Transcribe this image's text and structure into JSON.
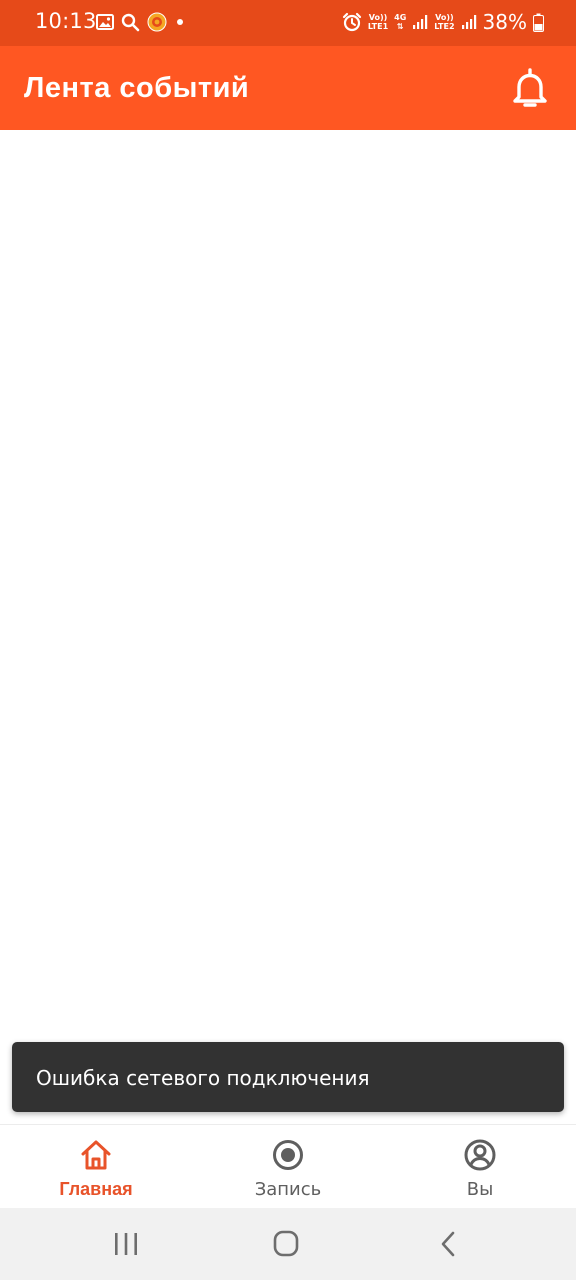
{
  "status_bar": {
    "time": "10:13",
    "battery_percent": "38%",
    "sim1_top": "Vo))",
    "sim1_bottom": "LTE1",
    "network_type": "4G",
    "sim2_top": "Vo))",
    "sim2_bottom": "LTE2",
    "background_color": "#e64a19"
  },
  "app_bar": {
    "title": "Лента событий",
    "background_color": "#ff5722",
    "notification_icon": "bell-icon"
  },
  "snackbar": {
    "message": "Ошибка сетевого подключения"
  },
  "bottom_nav": {
    "active_color": "#e8532a",
    "items": [
      {
        "label": "Главная",
        "icon": "home-icon",
        "active": true
      },
      {
        "label": "Запись",
        "icon": "record-icon",
        "active": false
      },
      {
        "label": "Вы",
        "icon": "profile-icon",
        "active": false
      }
    ]
  },
  "system_nav": {
    "buttons": [
      "recent-apps-icon",
      "home-circle-icon",
      "back-icon"
    ]
  }
}
